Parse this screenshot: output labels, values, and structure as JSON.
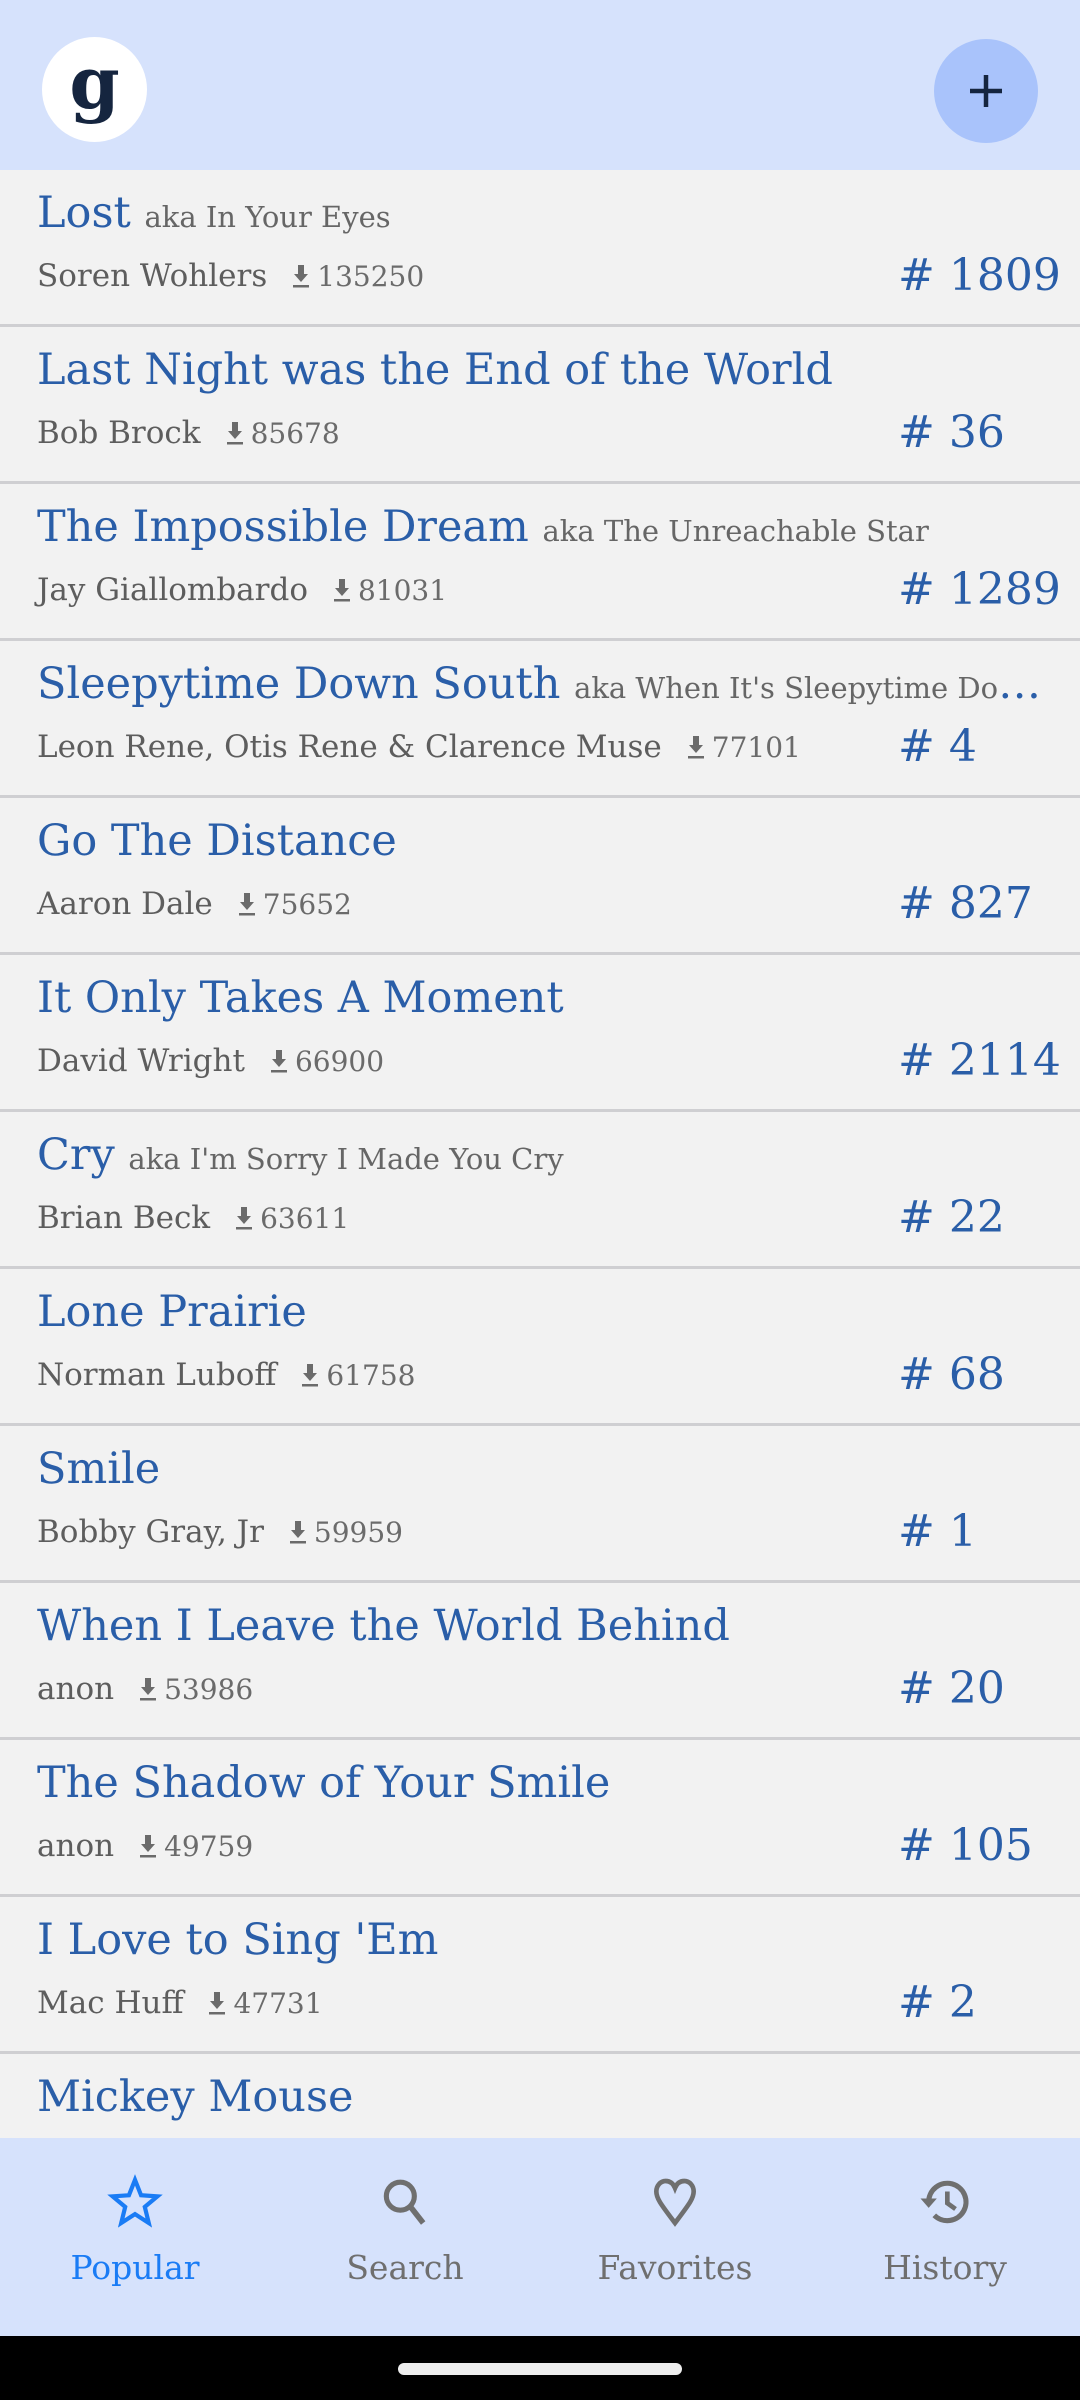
{
  "header": {
    "logo_letter": "g",
    "add_label": "+"
  },
  "songs": [
    {
      "title": "Lost",
      "aka": "aka In Your Eyes",
      "author": "Soren Wohlers",
      "downloads": "135250",
      "rank": "# 1809"
    },
    {
      "title": "Last Night was the End of the World",
      "aka": "",
      "author": "Bob Brock",
      "downloads": "85678",
      "rank": "# 36"
    },
    {
      "title": "The Impossible Dream",
      "aka": "aka The Unreachable Star",
      "author": "Jay Giallombardo",
      "downloads": "81031",
      "rank": "# 1289"
    },
    {
      "title": "Sleepytime Down South",
      "aka": "aka When It's Sleepytime Dow...",
      "author": "Leon Rene, Otis Rene & Clarence Muse",
      "downloads": "77101",
      "rank": "# 4"
    },
    {
      "title": "Go The Distance",
      "aka": "",
      "author": "Aaron Dale",
      "downloads": "75652",
      "rank": "# 827"
    },
    {
      "title": "It Only Takes A Moment",
      "aka": "",
      "author": "David Wright",
      "downloads": "66900",
      "rank": "# 2114"
    },
    {
      "title": "Cry",
      "aka": "aka I'm Sorry I Made You Cry",
      "author": "Brian Beck",
      "downloads": "63611",
      "rank": "# 22"
    },
    {
      "title": "Lone Prairie",
      "aka": "",
      "author": "Norman Luboff",
      "downloads": "61758",
      "rank": "# 68"
    },
    {
      "title": "Smile",
      "aka": "",
      "author": "Bobby Gray, Jr",
      "downloads": "59959",
      "rank": "# 1"
    },
    {
      "title": "When I Leave the World Behind",
      "aka": "",
      "author": "anon",
      "downloads": "53986",
      "rank": "# 20"
    },
    {
      "title": "The Shadow of Your Smile",
      "aka": "",
      "author": "anon",
      "downloads": "49759",
      "rank": "# 105"
    },
    {
      "title": "I Love to Sing 'Em",
      "aka": "",
      "author": "Mac Huff",
      "downloads": "47731",
      "rank": "# 2"
    },
    {
      "title": "Mickey Mouse",
      "aka": "",
      "author": "",
      "downloads": "",
      "rank": ""
    }
  ],
  "nav": {
    "items": [
      {
        "label": "Popular",
        "icon": "star-icon",
        "active": true
      },
      {
        "label": "Search",
        "icon": "search-icon"
      },
      {
        "label": "Favorites",
        "icon": "heart-icon"
      },
      {
        "label": "History",
        "icon": "history-icon"
      }
    ]
  },
  "colors": {
    "accent": "#2a5ea8",
    "active": "#1a7cf5",
    "bar": "#d6e2fc"
  }
}
